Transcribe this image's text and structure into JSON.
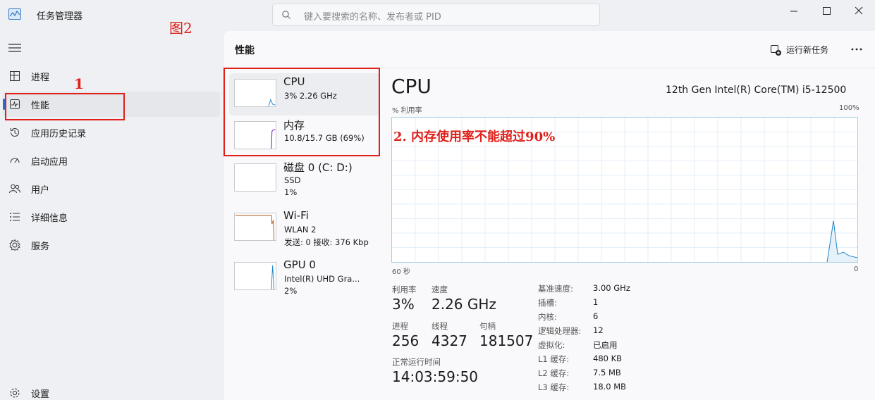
{
  "app": {
    "title": "任务管理器"
  },
  "search": {
    "placeholder": "键入要搜索的名称、发布者或 PID"
  },
  "annotations": {
    "figure": "图2",
    "step1": "1",
    "step2": "2. 内存使用率不能超过90%"
  },
  "sidebar": {
    "items": [
      {
        "label": "进程",
        "icon": "processes-icon"
      },
      {
        "label": "性能",
        "icon": "performance-icon",
        "active": true
      },
      {
        "label": "应用历史记录",
        "icon": "history-icon"
      },
      {
        "label": "启动应用",
        "icon": "startup-icon"
      },
      {
        "label": "用户",
        "icon": "users-icon"
      },
      {
        "label": "详细信息",
        "icon": "details-icon"
      },
      {
        "label": "服务",
        "icon": "services-icon"
      }
    ],
    "settings": "设置"
  },
  "header": {
    "title": "性能",
    "run_task": "运行新任务"
  },
  "resources": [
    {
      "name": "CPU",
      "line1": "3%  2.26 GHz",
      "line2": "",
      "color": "#1f86c9"
    },
    {
      "name": "内存",
      "line1": "10.8/15.7 GB (69%)",
      "line2": "",
      "color": "#8b2fc9"
    },
    {
      "name": "磁盘 0 (C: D:)",
      "line1": "SSD",
      "line2": "1%",
      "color": "#4c9b2f"
    },
    {
      "name": "Wi-Fi",
      "line1": "WLAN 2",
      "line2": "发送: 0  接收: 376 Kbp",
      "color": "#b5561f"
    },
    {
      "name": "GPU 0",
      "line1": "Intel(R) UHD Gra...",
      "line2": "2%",
      "color": "#1f86c9"
    }
  ],
  "cpu": {
    "title": "CPU",
    "model": "12th Gen Intel(R) Core(TM) i5-12500",
    "y_label": "% 利用率",
    "y_max": "100%",
    "x_left": "60 秒",
    "x_right": "0",
    "stats": {
      "util_label": "利用率",
      "util_value": "3%",
      "speed_label": "速度",
      "speed_value": "2.26 GHz",
      "proc_label": "进程",
      "proc_value": "256",
      "threads_label": "线程",
      "threads_value": "4327",
      "handles_label": "句柄",
      "handles_value": "181507",
      "uptime_label": "正常运行时间",
      "uptime_value": "14:03:59:50"
    },
    "specs": [
      {
        "label": "基准速度:",
        "value": "3.00 GHz"
      },
      {
        "label": "插槽:",
        "value": "1"
      },
      {
        "label": "内核:",
        "value": "6"
      },
      {
        "label": "逻辑处理器:",
        "value": "12"
      },
      {
        "label": "虚拟化:",
        "value": "已启用"
      },
      {
        "label": "L1 缓存:",
        "value": "480 KB"
      },
      {
        "label": "L2 缓存:",
        "value": "7.5 MB"
      },
      {
        "label": "L3 缓存:",
        "value": "18.0 MB"
      }
    ]
  }
}
